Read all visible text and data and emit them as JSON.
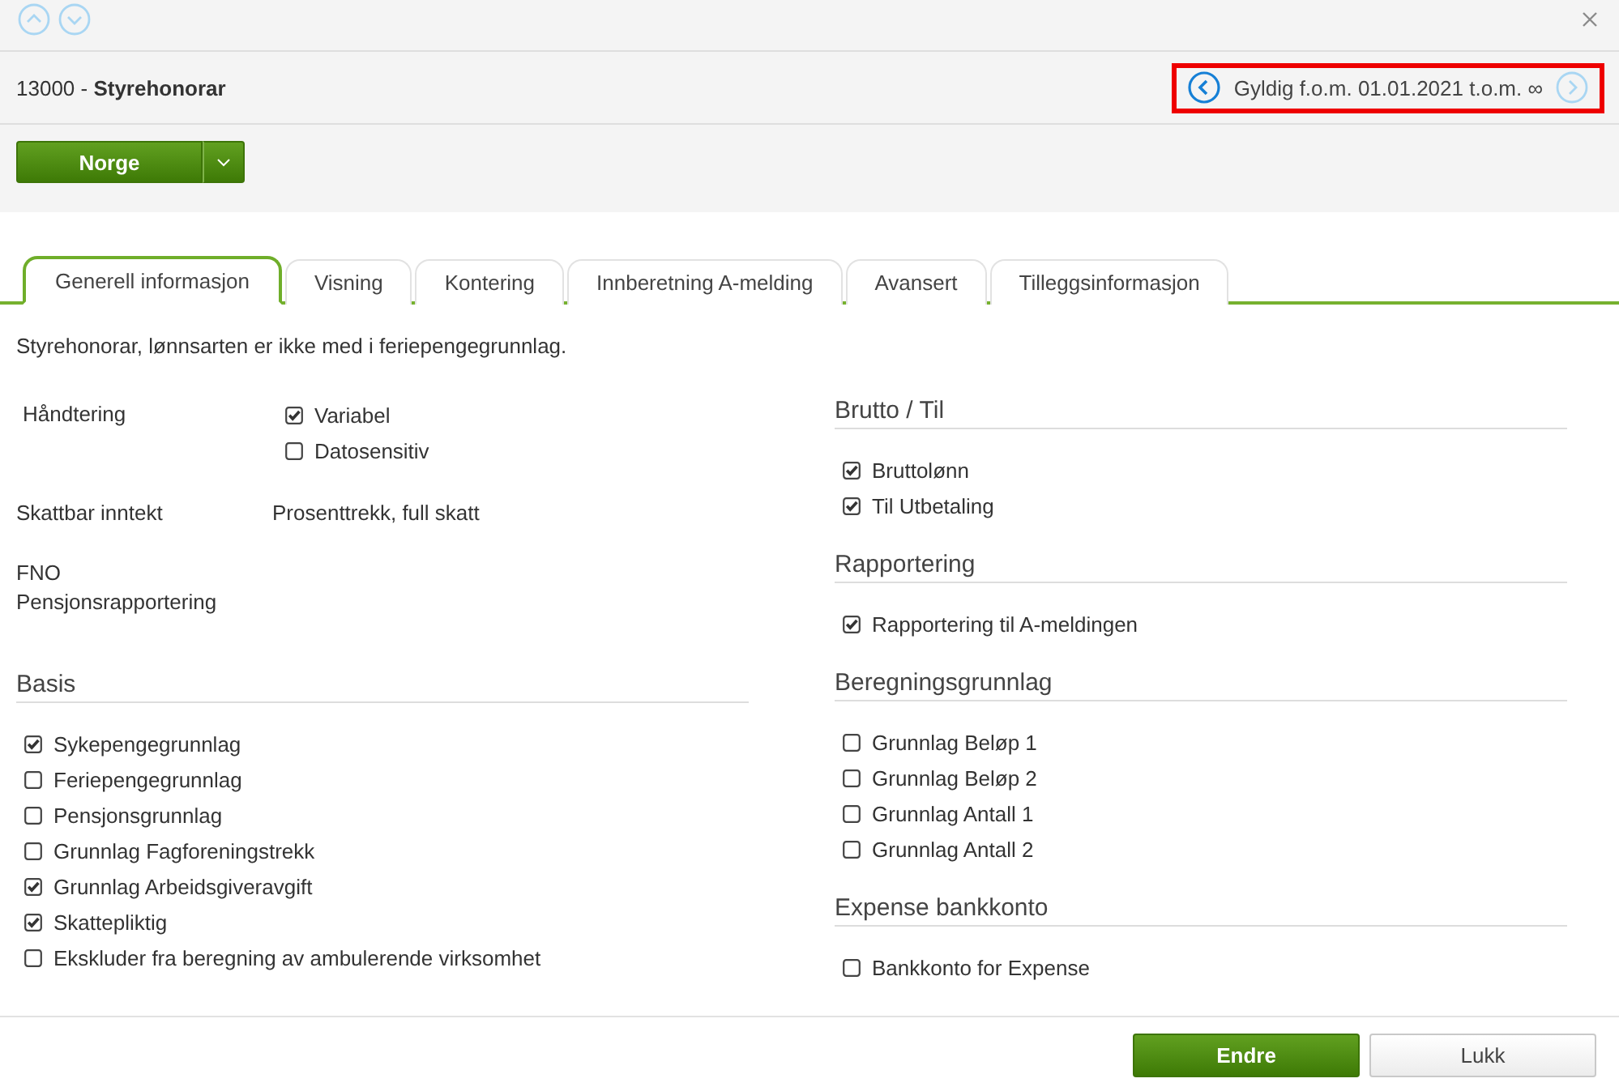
{
  "record_nav": [
    {
      "kind": "up",
      "disabled": true
    },
    {
      "kind": "down",
      "disabled": true
    }
  ],
  "title": "13000 - **Styrehonorar**",
  "validity": {
    "highlighted": true,
    "prev_disabled": false,
    "text": "Gyldig f.o.m. 01.01.2021 t.o.m. ∞",
    "next_disabled": true
  },
  "country_button": {
    "label": "Norge"
  },
  "tabs": [
    {
      "label": "Generell informasjon",
      "selected": true
    },
    {
      "label": "Visning",
      "selected": false
    },
    {
      "label": "Kontering",
      "selected": false
    },
    {
      "label": "Innberetning A-melding",
      "selected": false
    },
    {
      "label": "Avansert",
      "selected": false
    },
    {
      "label": "Tilleggsinformasjon",
      "selected": false
    }
  ],
  "description": "Styrehonorar, lønnsarten er ikke med i feriepengegrunnlag.",
  "fields": [
    {
      "kind": "checks",
      "label": "Håndtering",
      "options": [
        {
          "label": "Variabel",
          "checked": true
        },
        {
          "label": "Datosensitiv",
          "checked": false
        }
      ]
    },
    {
      "kind": "text",
      "label": "Skattbar inntekt",
      "value": "Prosenttrekk, full skatt"
    },
    {
      "kind": "text",
      "label": "FNO Pensjonsrapportering"
    }
  ],
  "left_sections": [
    {
      "title": "Basis",
      "items": [
        {
          "label": "Sykepengegrunnlag",
          "checked": true
        },
        {
          "label": "Feriepengegrunnlag",
          "checked": false
        },
        {
          "label": "Pensjonsgrunnlag",
          "checked": false
        },
        {
          "label": "Grunnlag Fagforeningstrekk",
          "checked": false
        },
        {
          "label": "Grunnlag Arbeidsgiveravgift",
          "checked": true
        },
        {
          "label": "Skattepliktig",
          "checked": true
        },
        {
          "label": "Ekskluder fra beregning av ambulerende virksomhet",
          "checked": false
        }
      ]
    }
  ],
  "right_sections": [
    {
      "title": "Brutto / Til",
      "items": [
        {
          "label": "Bruttolønn",
          "checked": true
        },
        {
          "label": "Til Utbetaling",
          "checked": true
        }
      ]
    },
    {
      "title": "Rapportering",
      "items": [
        {
          "label": "Rapportering til A-meldingen",
          "checked": true
        }
      ]
    },
    {
      "title": "Beregningsgrunnlag",
      "items": [
        {
          "label": "Grunnlag Beløp 1",
          "checked": false
        },
        {
          "label": "Grunnlag Beløp 2",
          "checked": false
        },
        {
          "label": "Grunnlag Antall 1",
          "checked": false
        },
        {
          "label": "Grunnlag Antall 2",
          "checked": false
        }
      ]
    },
    {
      "title": "Expense bankkonto",
      "items": [
        {
          "label": "Bankkonto for Expense",
          "checked": false
        }
      ]
    }
  ],
  "footer_buttons": [
    {
      "kind": "primary",
      "label": "Endre"
    },
    {
      "kind": "secondary",
      "label": "Lukk"
    }
  ]
}
